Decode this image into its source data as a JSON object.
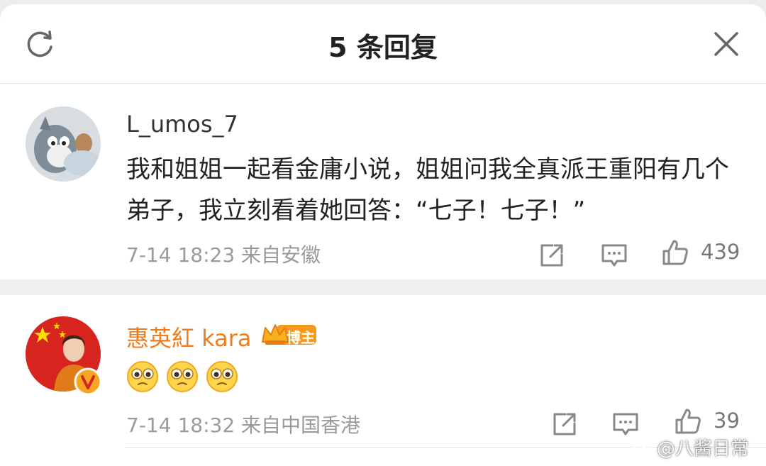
{
  "header": {
    "title": "5 条回复",
    "refresh_icon": "refresh-icon",
    "close_icon": "close-icon"
  },
  "comments": [
    {
      "username": "L_umos_7",
      "text": "我和姐姐一起看金庸小说，姐姐问我全真派王重阳有几个弟子，我立刻看着她回答：“七子！七子！”",
      "time": "7-14 18:23",
      "source": "来自安徽",
      "likes": "439",
      "avatar_icon": "cartoon-cat-avatar"
    },
    {
      "username": "惠英紅 kara",
      "badge": "博主",
      "emoji_count": 3,
      "emoji_icon": "tearful-face-emoji",
      "time": "7-14 18:32",
      "source": "来自中国香港",
      "likes": "39",
      "avatar_icon": "flag-portrait-avatar",
      "verified_icon": "verified-v-icon"
    }
  ],
  "watermark": {
    "text": "@八酱日常",
    "icon": "weibo-logo-icon"
  },
  "colors": {
    "accent_orange": "#f07d1c",
    "meta_gray": "#9a9a9a",
    "text_dark": "#222222"
  }
}
